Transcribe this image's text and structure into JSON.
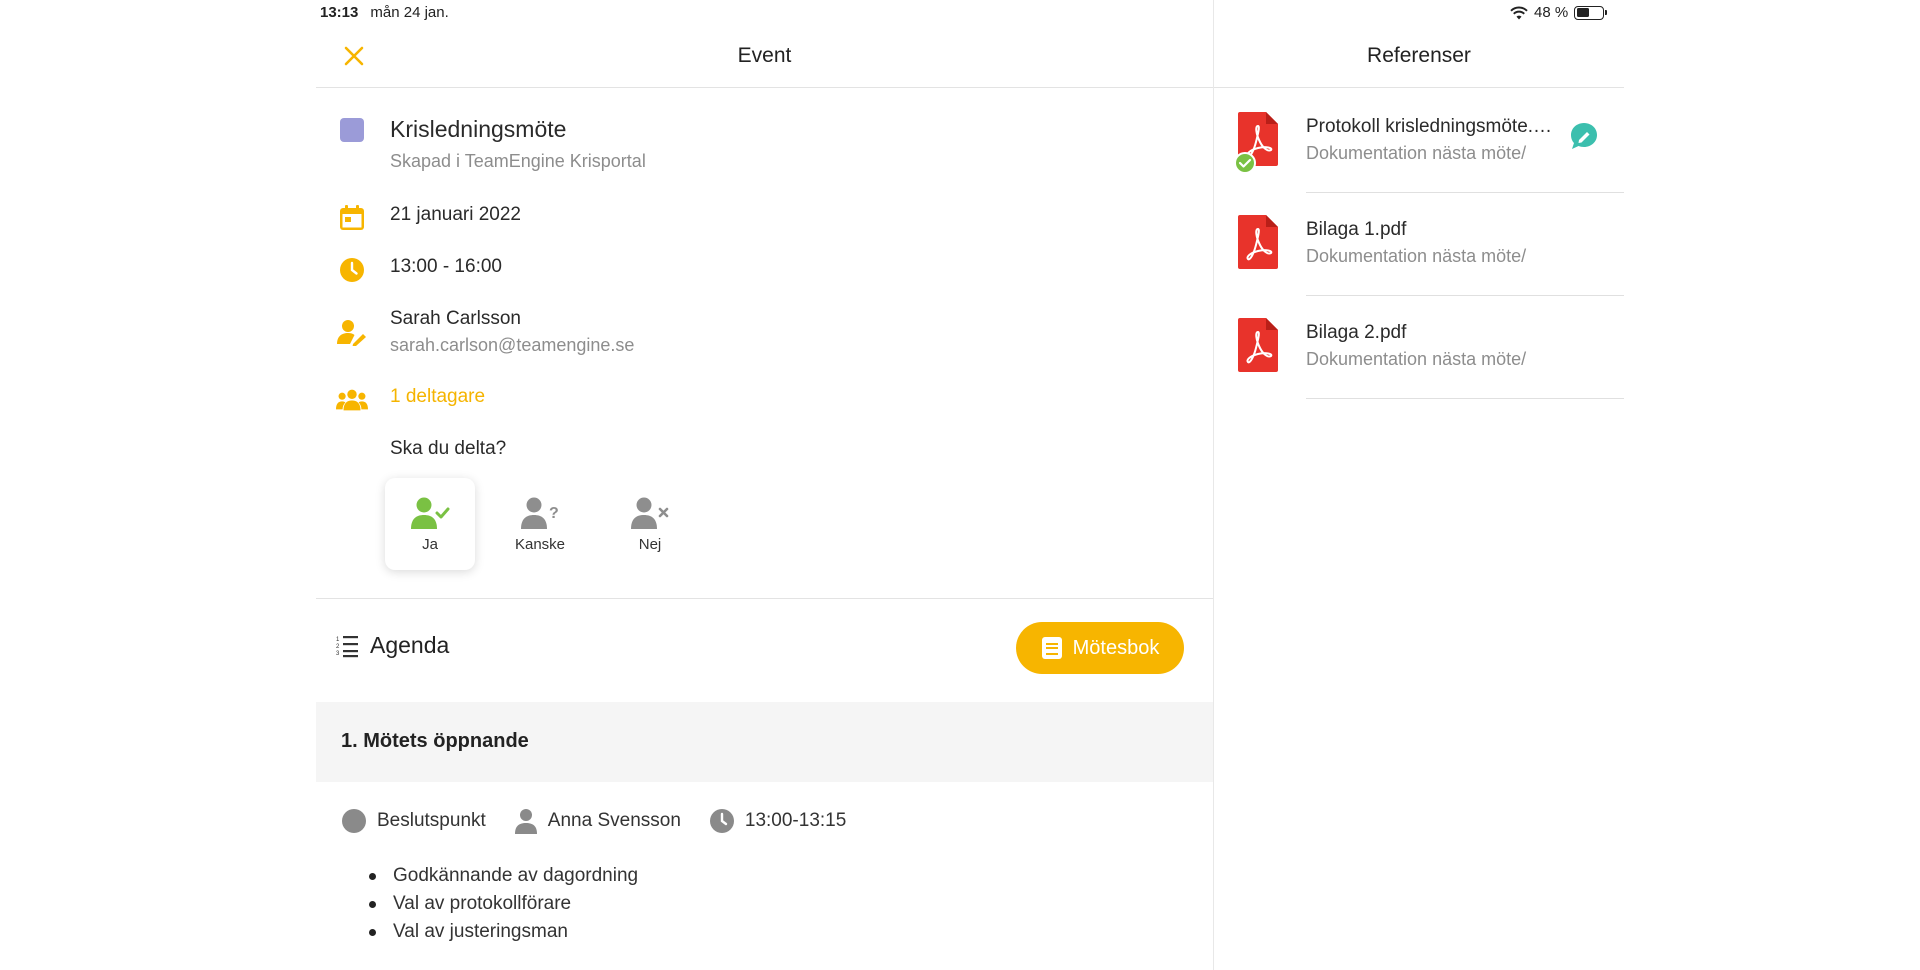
{
  "status_bar": {
    "time": "13:13",
    "date": "mån 24 jan.",
    "battery": "48 %",
    "battery_level": 0.48
  },
  "header": {
    "title": "Event"
  },
  "event": {
    "color": "#9b9bd8",
    "title": "Krisledningsmöte",
    "subtitle": "Skapad i TeamEngine Krisportal",
    "date": "21 januari 2022",
    "time": "13:00 - 16:00",
    "organizer_name": "Sarah Carlsson",
    "organizer_email": "sarah.carlson@teamengine.se",
    "participants": "1 deltagare",
    "question": "Ska du delta?"
  },
  "rsvp": {
    "options": [
      {
        "label": "Ja",
        "icon": "person-check-icon",
        "selected": true
      },
      {
        "label": "Kanske",
        "icon": "person-question-icon",
        "selected": false
      },
      {
        "label": "Nej",
        "icon": "person-x-icon",
        "selected": false
      }
    ]
  },
  "agenda": {
    "title": "Agenda",
    "button_label": "Mötesbok",
    "items": [
      {
        "title": "1. Mötets öppnande",
        "type": "Beslutspunkt",
        "responsible": "Anna Svensson",
        "time": "13:00-13:15",
        "points": [
          "Godkännande av dagordning",
          "Val av protokollförare",
          "Val av justeringsman"
        ]
      }
    ]
  },
  "references": {
    "title": "Referenser",
    "items": [
      {
        "name": "Protokoll krisledningsmöte.pdf",
        "path": "Dokumentation nästa möte/",
        "checked": true,
        "has_note": true
      },
      {
        "name": "Bilaga 1.pdf",
        "path": "Dokumentation nästa möte/",
        "checked": false,
        "has_note": false
      },
      {
        "name": "Bilaga 2.pdf",
        "path": "Dokumentation nästa möte/",
        "checked": false,
        "has_note": false
      }
    ]
  },
  "colors": {
    "accent": "#f7b500",
    "yes_green": "#7ac143",
    "pdf_red": "#e8332b",
    "note_teal": "#3cbfae"
  }
}
